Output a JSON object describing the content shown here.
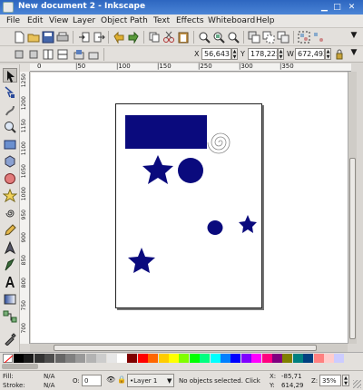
{
  "window": {
    "title": "New document 2 - Inkscape"
  },
  "menu": [
    "File",
    "Edit",
    "View",
    "Layer",
    "Object",
    "Path",
    "Text",
    "Effects",
    "Whiteboard",
    "Help"
  ],
  "selector_toolbar": {
    "x_label": "X",
    "x_value": "56,643",
    "y_label": "Y",
    "y_value": "178,225",
    "w_label": "W",
    "w_value": "672,492"
  },
  "ruler_h_ticks": [
    "0",
    "|50",
    "|100",
    "|150",
    "|250",
    "|300",
    "|350"
  ],
  "ruler_v_ticks": [
    "1250",
    "1200",
    "1150",
    "1100",
    "1050",
    "1000",
    "950",
    "900",
    "850",
    "800",
    "750",
    "700"
  ],
  "palette_colors": [
    "#000000",
    "#1a1a1a",
    "#333333",
    "#4d4d4d",
    "#666666",
    "#808080",
    "#999999",
    "#b3b3b3",
    "#cccccc",
    "#e6e6e6",
    "#ffffff",
    "#800000",
    "#ff0000",
    "#ff6600",
    "#ffcc00",
    "#ffff00",
    "#80ff00",
    "#00ff00",
    "#00ff80",
    "#00ffff",
    "#0080ff",
    "#0000ff",
    "#8000ff",
    "#ff00ff",
    "#ff0080",
    "#800080",
    "#808000",
    "#008080",
    "#004080",
    "#ff8080",
    "#ffcccc",
    "#ccccff"
  ],
  "status": {
    "fill_label": "Fill:",
    "fill_value": "N/A",
    "stroke_label": "Stroke:",
    "stroke_value": "N/A",
    "opacity_label": "O:",
    "opacity_value": "0",
    "layer_name": "•Layer 1",
    "message": "No objects selected. Click",
    "x_label": "X:",
    "x_value": "-85,71",
    "y_label": "Y:",
    "y_value": "614,29",
    "zoom_label": "Z:",
    "zoom_value": "35%"
  },
  "shapes": {
    "fill_color": "#0a0a7d",
    "spiral_color": "#888888"
  }
}
